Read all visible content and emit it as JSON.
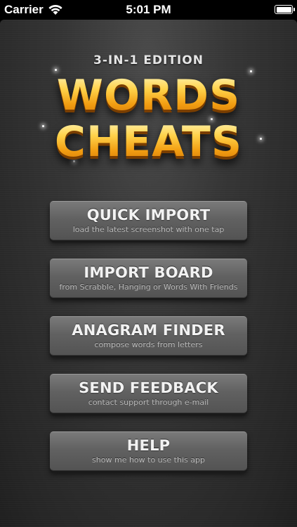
{
  "status_bar": {
    "carrier": "Carrier",
    "time": "5:01 PM",
    "wifi_icon": "wifi-icon",
    "battery_icon": "battery-full-icon"
  },
  "header": {
    "edition": "3-IN-1 EDITION",
    "logo_line1": "WORDS",
    "logo_line2": "CHEATS"
  },
  "menu": [
    {
      "title": "QUICK IMPORT",
      "subtitle": "load the latest screenshot with one tap"
    },
    {
      "title": "IMPORT BOARD",
      "subtitle": "from Scrabble, Hanging or Words With Friends"
    },
    {
      "title": "ANAGRAM FINDER",
      "subtitle": "compose words from letters"
    },
    {
      "title": "SEND FEEDBACK",
      "subtitle": "contact support through e-mail"
    },
    {
      "title": "HELP",
      "subtitle": "show me how to use this app"
    }
  ],
  "colors": {
    "logo_gold": "#f6b21d",
    "button_gray": "#616161",
    "background": "#2c2c2c"
  }
}
